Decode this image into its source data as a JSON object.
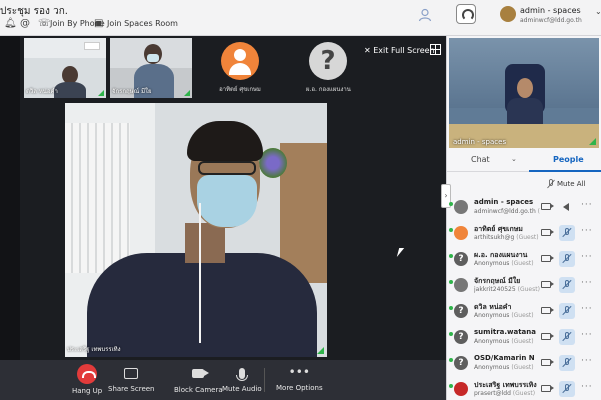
{
  "topbar": {
    "meeting_title": "ประชุม รอง วก.",
    "join_by_phone": "Join By Phone",
    "join_spaces_room": "Join Spaces Room",
    "user_name": "admin - spaces",
    "user_email": "adminwcf@ldd.go.th"
  },
  "thumbnails": [
    {
      "name": "ดวิล หน่อคำ"
    },
    {
      "name": "จักรกฤษณ์ มีใย"
    }
  ],
  "avatars": [
    {
      "name": "อาทิตย์ ศุขเกษม",
      "kind": "person"
    },
    {
      "name": "ผ.อ. กองแผนงาน",
      "kind": "question"
    }
  ],
  "exit_full_screen": "Exit Full Screen",
  "main_video": {
    "name": "ประเสริฐ เทพบรรเทิง"
  },
  "toolbar": {
    "hang_up": "Hang Up",
    "share_screen": "Share Screen",
    "block_camera": "Block Camera",
    "mute_audio": "Mute Audio",
    "more_options": "More Options"
  },
  "side_video": {
    "label": "admin - spaces"
  },
  "tabs": {
    "chat": "Chat",
    "people": "People"
  },
  "mute_all": "Mute All",
  "participants": [
    {
      "name": "admin - spaces",
      "sub": "adminwcf@ldd.go.th",
      "role": "(Admin)",
      "avatar": "person",
      "mic": "speaker"
    },
    {
      "name": "อาทิตย์ ศุขเกษม",
      "sub": "arthitsukh@g",
      "role": "(Guest)",
      "avatar": "orange",
      "mic": "muted"
    },
    {
      "name": "ผ.อ. กองแผนงาน",
      "sub": "Anonymous",
      "role": "(Guest)",
      "avatar": "q",
      "mic": "muted"
    },
    {
      "name": "จักรกฤษณ์ มีใย",
      "sub": "jakkrit240525",
      "role": "(Guest)",
      "avatar": "person",
      "mic": "muted"
    },
    {
      "name": "ดวิล หน่อคำ",
      "sub": "Anonymous",
      "role": "(Guest)",
      "avatar": "q",
      "mic": "muted"
    },
    {
      "name": "sumitra.watana",
      "sub": "Anonymous",
      "role": "(Guest)",
      "avatar": "q",
      "mic": "muted"
    },
    {
      "name": "OSD/Kamarin N",
      "sub": "Anonymous",
      "role": "(Guest)",
      "avatar": "q",
      "mic": "muted"
    },
    {
      "name": "ประเสริฐ เทพบรรเทิง",
      "sub": "prasert@ldd",
      "role": "(Guest)",
      "avatar": "red",
      "mic": "muted"
    }
  ]
}
